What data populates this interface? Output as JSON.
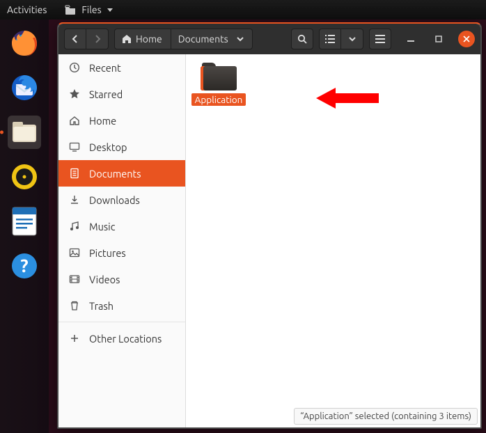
{
  "panel": {
    "activities": "Activities",
    "files": "Files"
  },
  "dock": {
    "apps": [
      "firefox",
      "thunderbird",
      "files",
      "music",
      "writer",
      "help"
    ],
    "active": "files"
  },
  "header": {
    "home": "Home",
    "currentFolder": "Documents"
  },
  "sidebar": {
    "items": [
      {
        "key": "recent",
        "label": "Recent"
      },
      {
        "key": "starred",
        "label": "Starred"
      },
      {
        "key": "home",
        "label": "Home"
      },
      {
        "key": "desktop",
        "label": "Desktop"
      },
      {
        "key": "documents",
        "label": "Documents"
      },
      {
        "key": "downloads",
        "label": "Downloads"
      },
      {
        "key": "music",
        "label": "Music"
      },
      {
        "key": "pictures",
        "label": "Pictures"
      },
      {
        "key": "videos",
        "label": "Videos"
      },
      {
        "key": "trash",
        "label": "Trash"
      },
      {
        "key": "other",
        "label": "Other Locations"
      }
    ],
    "active": "documents"
  },
  "content": {
    "folders": [
      {
        "name": "Application",
        "selected": true
      }
    ]
  },
  "status": {
    "text": "“Application” selected  (containing 3 items)"
  }
}
